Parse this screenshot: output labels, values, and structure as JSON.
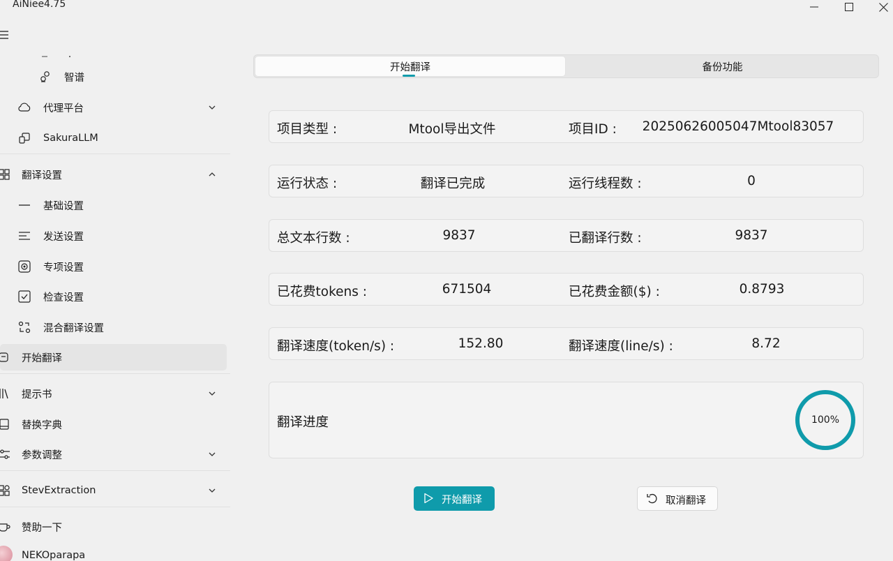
{
  "window": {
    "title": "AiNiee4.75"
  },
  "sidebar": {
    "items": [
      {
        "label": "智谱",
        "icon": "zhipu-icon"
      },
      {
        "label": "代理平台",
        "icon": "cloud-icon"
      },
      {
        "label": "SakuraLLM",
        "icon": "sakura-icon"
      },
      {
        "label": "翻译设置",
        "icon": "settings-group-icon"
      },
      {
        "label": "基础设置",
        "icon": "dash-icon"
      },
      {
        "label": "发送设置",
        "icon": "lines-icon"
      },
      {
        "label": "专项设置",
        "icon": "target-icon"
      },
      {
        "label": "检查设置",
        "icon": "checkbox-icon"
      },
      {
        "label": "混合翻译设置",
        "icon": "mix-icon"
      },
      {
        "label": "开始翻译",
        "icon": "play-icon"
      },
      {
        "label": "提示书",
        "icon": "books-icon"
      },
      {
        "label": "替换字典",
        "icon": "dictionary-icon"
      },
      {
        "label": "参数调整",
        "icon": "sliders-icon"
      },
      {
        "label": "StevExtraction",
        "icon": "extraction-icon"
      },
      {
        "label": "赞助一下",
        "icon": "coffee-icon"
      },
      {
        "label": "NEKOparapa",
        "icon": "avatar"
      }
    ]
  },
  "tabs": [
    {
      "label": "开始翻译"
    },
    {
      "label": "备份功能"
    }
  ],
  "cards": [
    {
      "label1": "项目类型 :",
      "value1": "Mtool导出文件",
      "label2": "项目ID :",
      "value2": "20250626005047Mtool83057"
    },
    {
      "label1": "运行状态 :",
      "value1": "翻译已完成",
      "label2": "运行线程数 :",
      "value2": "0"
    },
    {
      "label1": "总文本行数 :",
      "value1": "9837",
      "label2": "已翻译行数 :",
      "value2": "9837"
    },
    {
      "label1": "已花费tokens :",
      "value1": "671504",
      "label2": "已花费金额($) :",
      "value2": "0.8793"
    },
    {
      "label1": "翻译速度(token/s) :",
      "value1": "152.80",
      "label2": "翻译速度(line/s) :",
      "value2": "8.72"
    }
  ],
  "progress": {
    "label": "翻译进度",
    "text": "100%",
    "fraction": 1.0
  },
  "buttons": {
    "start": "开始翻译",
    "cancel": "取消翻译"
  },
  "colors": {
    "accent": "#0f9bab"
  }
}
